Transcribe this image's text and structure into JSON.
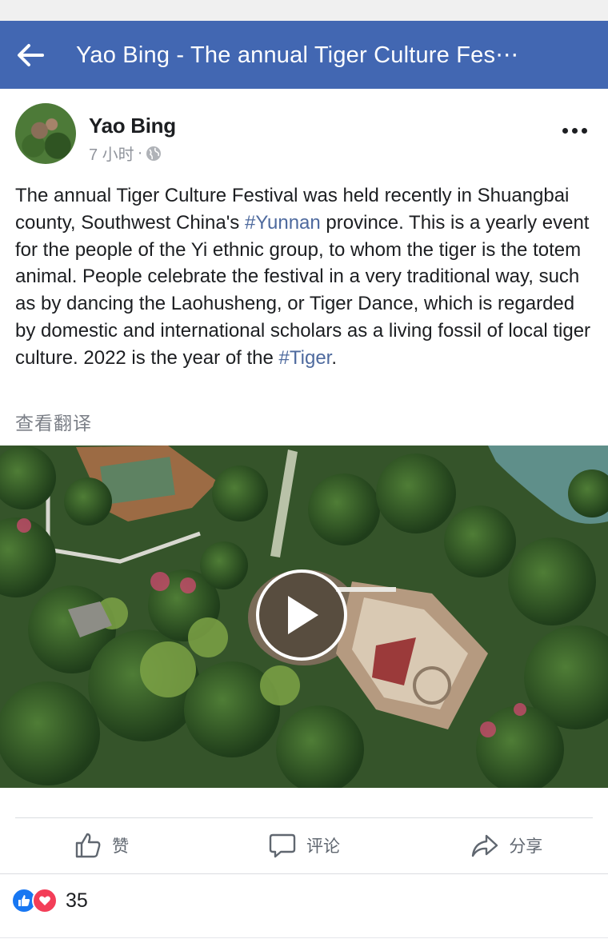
{
  "header": {
    "title": "Yao Bing - The annual Tiger Culture Fes⋯"
  },
  "post": {
    "author": "Yao Bing",
    "time": "7 小时",
    "separator": "·",
    "text": {
      "p1": "The annual Tiger Culture Festival was held recently in Shuangbai county, Southwest China's ",
      "tag1": "#Yunnan",
      "p2": " province. This is a yearly event for the people of the Yi ethnic group, to whom the tiger is the totem animal. People celebrate the festival in a very traditional way, such as by dancing the Laohusheng, or Tiger Dance, which is regarded by domestic and international scholars as a living fossil of local tiger culture. 2022 is the year of the ",
      "tag2": "#Tiger",
      "p3": "."
    },
    "translate_label": "查看翻译"
  },
  "actions": {
    "like": "赞",
    "comment": "评论",
    "share": "分享"
  },
  "reactions": {
    "count": "35"
  },
  "colors": {
    "brand": "#4267b2",
    "hashtag": "#4e6a9e",
    "like": "#1877f2",
    "love": "#f33e58"
  },
  "icons": [
    "back-arrow-icon",
    "globe-icon",
    "more-icon",
    "play-icon",
    "like-icon",
    "comment-icon",
    "share-icon",
    "like-reaction-icon",
    "love-reaction-icon"
  ]
}
